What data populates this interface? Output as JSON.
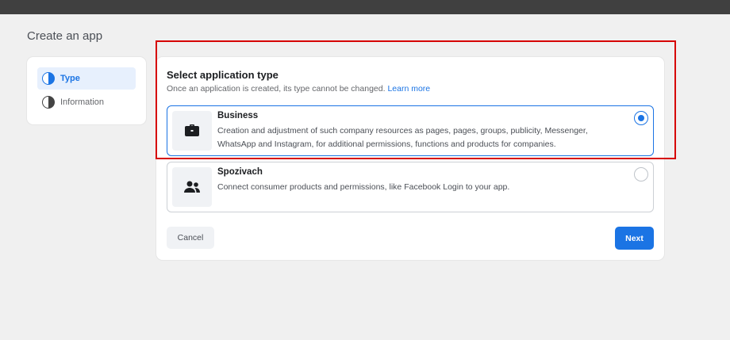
{
  "page": {
    "title": "Create an app"
  },
  "steps": [
    {
      "label": "Type",
      "active": true
    },
    {
      "label": "Information",
      "active": false
    }
  ],
  "selection": {
    "title": "Select application type",
    "description": "Once an application is created, its type cannot be changed.",
    "learn_more": "Learn more",
    "options": [
      {
        "title": "Business",
        "description": "Creation and adjustment of such company resources as pages, pages, groups, publicity, Messenger, WhatsApp and Instagram, for additional permissions, functions and products for companies.",
        "icon": "briefcase-icon",
        "selected": true
      },
      {
        "title": "Spozivach",
        "description": "Connect consumer products and permissions, like Facebook Login to your app.",
        "icon": "people-icon",
        "selected": false
      }
    ]
  },
  "actions": {
    "cancel_label": "Cancel",
    "next_label": "Next"
  },
  "colors": {
    "accent": "#1b74e4",
    "highlight": "#d60000",
    "topbar": "#404040"
  }
}
